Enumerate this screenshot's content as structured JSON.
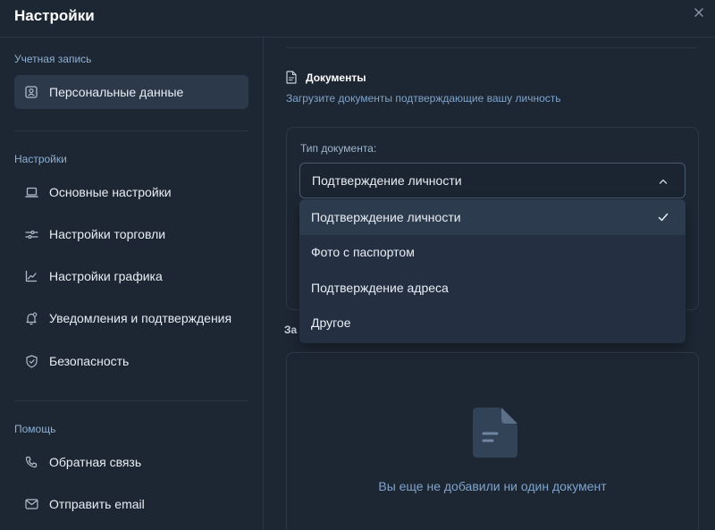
{
  "window": {
    "title": "Настройки"
  },
  "sidebar": {
    "sections": [
      {
        "label": "Учетная запись"
      },
      {
        "label": "Настройки"
      },
      {
        "label": "Помощь"
      }
    ],
    "items": [
      {
        "label": "Персональные данные",
        "icon": "user-card-icon",
        "active": true
      },
      {
        "label": "Основные настройки",
        "icon": "laptop-icon"
      },
      {
        "label": "Настройки торговли",
        "icon": "sliders-icon"
      },
      {
        "label": "Настройки графика",
        "icon": "chart-line-icon"
      },
      {
        "label": "Уведомления и подтверждения",
        "icon": "bell-icon"
      },
      {
        "label": "Безопасность",
        "icon": "shield-icon"
      },
      {
        "label": "Обратная связь",
        "icon": "phone-icon"
      },
      {
        "label": "Отправить email",
        "icon": "mail-icon"
      }
    ]
  },
  "documents": {
    "title": "Документы",
    "subtitle": "Загрузите документы подтверждающие вашу личность",
    "type_label": "Тип документа:",
    "selected": "Подтверждение личности",
    "options": [
      "Подтверждение личности",
      "Фото с паспортом",
      "Подтверждение адреса",
      "Другое"
    ],
    "uploaded_section_fragment": "За",
    "empty_text": "Вы еще не добавили ни один документ"
  },
  "colors": {
    "background": "#1d2734",
    "active_item": "#2b394b",
    "accent_text": "#7fa3cb",
    "dropdown": "#243042"
  }
}
